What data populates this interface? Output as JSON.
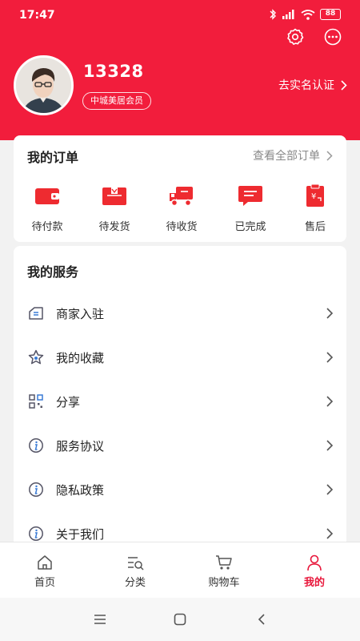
{
  "status": {
    "time": "17:47",
    "battery": "88"
  },
  "profile": {
    "username": "13328",
    "member_badge": "中城美居会员",
    "verify_link": "去实名认证"
  },
  "orders": {
    "title": "我的订单",
    "view_all": "查看全部订单",
    "items": [
      {
        "label": "待付款",
        "icon": "wallet-icon"
      },
      {
        "label": "待发货",
        "icon": "package-icon"
      },
      {
        "label": "待收货",
        "icon": "truck-icon"
      },
      {
        "label": "已完成",
        "icon": "message-icon"
      },
      {
        "label": "售后",
        "icon": "refund-icon"
      }
    ]
  },
  "services": {
    "title": "我的服务",
    "items": [
      {
        "label": "商家入驻",
        "icon": "store-icon"
      },
      {
        "label": "我的收藏",
        "icon": "star-icon"
      },
      {
        "label": "分享",
        "icon": "qr-icon"
      },
      {
        "label": "服务协议",
        "icon": "info-icon"
      },
      {
        "label": "隐私政策",
        "icon": "info-icon"
      },
      {
        "label": "关于我们",
        "icon": "info-icon"
      }
    ]
  },
  "tabbar": {
    "items": [
      {
        "label": "首页",
        "icon": "home-icon"
      },
      {
        "label": "分类",
        "icon": "category-icon"
      },
      {
        "label": "购物车",
        "icon": "cart-icon"
      },
      {
        "label": "我的",
        "icon": "user-icon"
      }
    ],
    "active": "我的"
  },
  "colors": {
    "brand": "#f21d3c",
    "active_tab": "#e8163a"
  }
}
